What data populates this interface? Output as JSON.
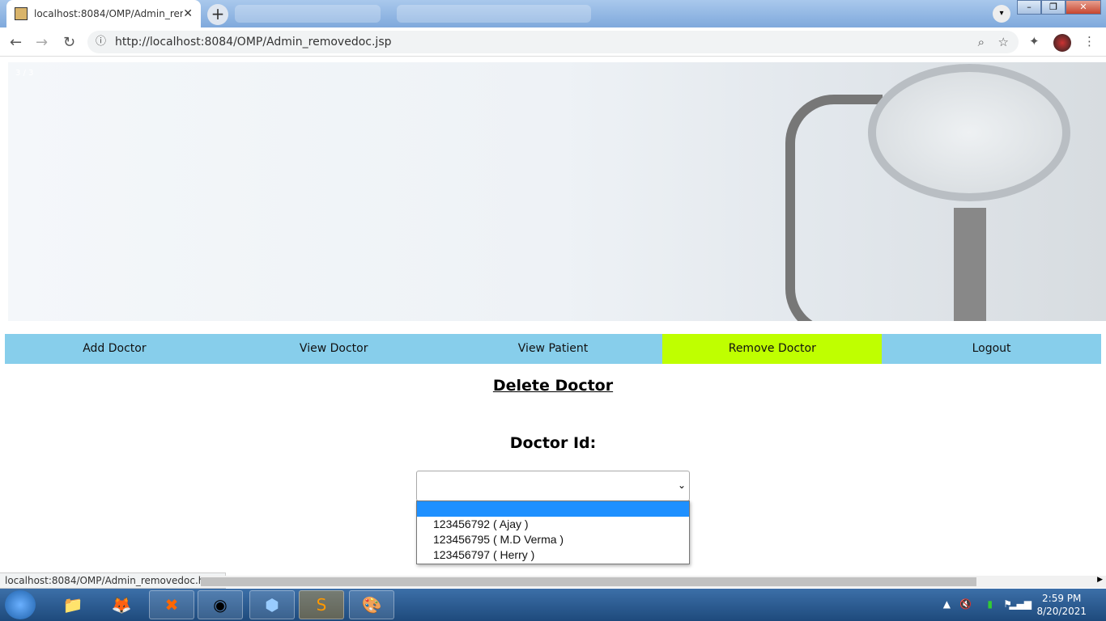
{
  "browser": {
    "tab_title": "localhost:8084/OMP/Admin_removedoc.jsp",
    "tab_display": "localhost:8084/OMP/Admin_rem",
    "url": "http://localhost:8084/OMP/Admin_removedoc.jsp",
    "status_url": "localhost:8084/OMP/Admin_removedoc.html"
  },
  "hero": {
    "counter": "3 / 3"
  },
  "menu": [
    {
      "label": "Add Doctor",
      "active": false
    },
    {
      "label": "View Doctor",
      "active": false
    },
    {
      "label": "View Patient",
      "active": false
    },
    {
      "label": "Remove Doctor",
      "active": true
    },
    {
      "label": "Logout",
      "active": false
    }
  ],
  "colors": {
    "menu_bg": "#87ceeb",
    "menu_active": "#bfff00",
    "option_highlight": "#1e90ff"
  },
  "page": {
    "heading": "Delete Doctor",
    "field_label": "Doctor Id:"
  },
  "doctor_select": {
    "value": "",
    "options": [
      "",
      "123456792 ( Ajay )",
      "123456795 ( M.D Verma )",
      "123456797 ( Herry )"
    ]
  },
  "taskbar": {
    "time": "2:59 PM",
    "date": "8/20/2021"
  }
}
